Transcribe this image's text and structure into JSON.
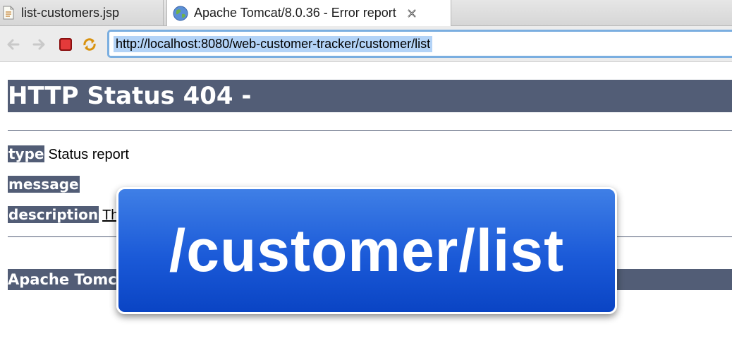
{
  "tabs": [
    {
      "label": "list-customers.jsp",
      "active": false,
      "icon": "jsp-file-icon"
    },
    {
      "label": "Apache Tomcat/8.0.36 - Error report",
      "active": true,
      "icon": "globe-icon"
    }
  ],
  "toolbar": {
    "url": "http://localhost:8080/web-customer-tracker/customer/list"
  },
  "page": {
    "heading": "HTTP Status 404 - ",
    "fields": {
      "type_label": "type",
      "type_value": "Status report",
      "message_label": "message",
      "message_value": "",
      "description_label": "description",
      "description_value": "The"
    },
    "footer": "Apache Tomcat/8.0.36"
  },
  "callout": {
    "text": "/customer/list"
  },
  "colors": {
    "tomcat_header": "#525d76",
    "callout_blue": "#1b5ad8",
    "url_focus": "#7aaee0"
  }
}
